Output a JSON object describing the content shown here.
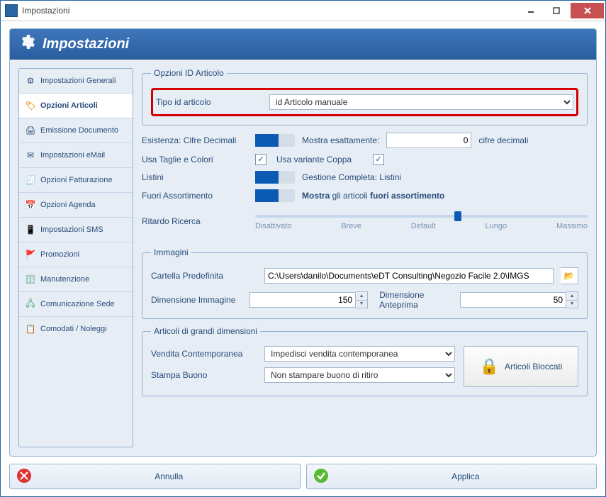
{
  "window": {
    "title": "Impostazioni"
  },
  "header": {
    "title": "Impostazioni"
  },
  "sidebar": {
    "items": [
      {
        "label": "Impostazioni Generali"
      },
      {
        "label": "Opzioni Articoli"
      },
      {
        "label": "Emissione Documento"
      },
      {
        "label": "Impostazioni eMail"
      },
      {
        "label": "Opzioni Fatturazione"
      },
      {
        "label": "Opzioni Agenda"
      },
      {
        "label": "Impostazioni SMS"
      },
      {
        "label": "Promozioni"
      },
      {
        "label": "Manutenzione"
      },
      {
        "label": "Comunicazione Sede"
      },
      {
        "label": "Comodati / Noleggi"
      }
    ]
  },
  "group_id_articolo": {
    "legend": "Opzioni ID Articolo",
    "tipo_label": "Tipo id articolo",
    "tipo_value": "id Articolo manuale"
  },
  "opts": {
    "esistenza_label": "Esistenza: Cifre Decimali",
    "mostra_esattamente_label": "Mostra esattamente:",
    "mostra_esattamente_value": "0",
    "cifre_decimali_suffix": "cifre decimali",
    "usa_taglie_label": "Usa Taglie e Colori",
    "usa_variante_label": "Usa variante Coppa",
    "listini_label": "Listini",
    "listini_text": "Gestione Completa: Listini",
    "fuori_label": "Fuori Assortimento",
    "fuori_prefix": "Mostra",
    "fuori_mid": " gli articoli ",
    "fuori_bold": "fuori assortimento",
    "ritardo_label": "Ritardo Ricerca",
    "slider_labels": [
      "Disattivato",
      "Breve",
      "Default",
      "Lungo",
      "Massimo"
    ]
  },
  "group_immagini": {
    "legend": "Immagini",
    "cartella_label": "Cartella Predefinita",
    "cartella_value": "C:\\Users\\danilo\\Documents\\eDT Consulting\\Negozio Facile 2.0\\IMGS",
    "dim_img_label": "Dimensione Immagine",
    "dim_img_value": "150",
    "dim_ant_label": "Dimensione Anteprima",
    "dim_ant_value": "50"
  },
  "group_grandi": {
    "legend": "Articoli di grandi dimensioni",
    "vendita_label": "Vendita Contemporanea",
    "vendita_value": "Impedisci vendita contemporanea",
    "stampa_label": "Stampa Buono",
    "stampa_value": "Non stampare buono di ritiro",
    "bloccati_label": "Articoli Bloccati"
  },
  "footer": {
    "annulla": "Annulla",
    "applica": "Applica"
  }
}
